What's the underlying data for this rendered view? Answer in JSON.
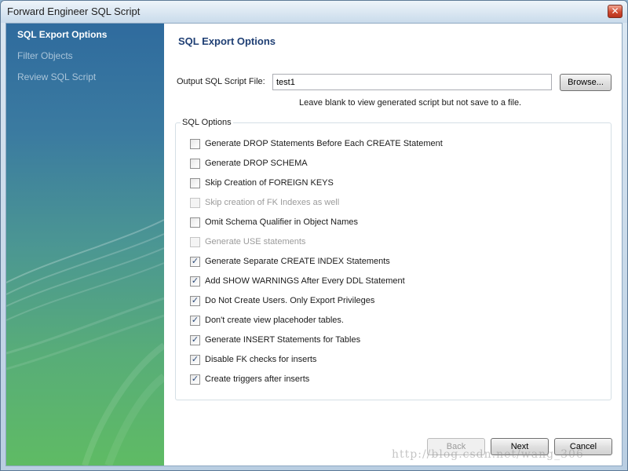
{
  "window": {
    "title": "Forward Engineer SQL Script",
    "close_glyph": "✕"
  },
  "sidebar": {
    "items": [
      {
        "label": "SQL Export Options",
        "active": true
      },
      {
        "label": "Filter Objects",
        "active": false
      },
      {
        "label": "Review SQL Script",
        "active": false
      }
    ]
  },
  "main": {
    "title": "SQL Export Options",
    "output_file": {
      "label": "Output SQL Script File:",
      "value": "test1",
      "browse_label": "Browse..."
    },
    "hint": "Leave blank to view generated script but not save to a file.",
    "options_group": {
      "legend": "SQL Options",
      "options": [
        {
          "label": "Generate DROP Statements Before Each CREATE Statement",
          "checked": false,
          "enabled": true
        },
        {
          "label": "Generate DROP SCHEMA",
          "checked": false,
          "enabled": true
        },
        {
          "label": "Skip Creation of FOREIGN KEYS",
          "checked": false,
          "enabled": true
        },
        {
          "label": "Skip creation of FK Indexes as well",
          "checked": false,
          "enabled": false
        },
        {
          "label": "Omit Schema Qualifier in Object Names",
          "checked": false,
          "enabled": true
        },
        {
          "label": "Generate USE statements",
          "checked": false,
          "enabled": false
        },
        {
          "label": "Generate Separate CREATE INDEX Statements",
          "checked": true,
          "enabled": true
        },
        {
          "label": "Add SHOW WARNINGS After Every DDL Statement",
          "checked": true,
          "enabled": true
        },
        {
          "label": "Do Not Create Users. Only Export Privileges",
          "checked": true,
          "enabled": true
        },
        {
          "label": "Don't create view placehoder tables.",
          "checked": true,
          "enabled": true
        },
        {
          "label": "Generate INSERT Statements for Tables",
          "checked": true,
          "enabled": true
        },
        {
          "label": "Disable FK checks for inserts",
          "checked": true,
          "enabled": true
        },
        {
          "label": "Create triggers after inserts",
          "checked": true,
          "enabled": true
        }
      ]
    }
  },
  "footer": {
    "back_label": "Back",
    "next_label": "Next",
    "cancel_label": "Cancel"
  },
  "watermark": "http://blog.csdn.net/wang_306",
  "colors": {
    "accent_title": "#1f3f74",
    "sidebar_top": "#2f6b9e",
    "sidebar_bottom": "#5fbb64"
  }
}
